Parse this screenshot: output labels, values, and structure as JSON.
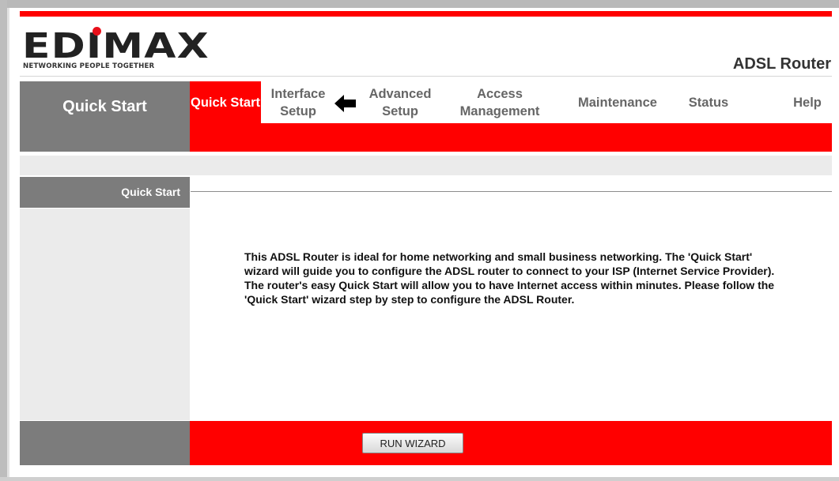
{
  "brand": {
    "logo_text": "EDIMAX",
    "tagline": "NETWORKING PEOPLE TOGETHER",
    "product": "ADSL Router",
    "accent_color": "#ff0000",
    "gray_color": "#7c7c7c"
  },
  "nav": {
    "section_title": "Quick Start",
    "tabs": [
      {
        "label": "Quick Start",
        "active": true
      },
      {
        "label": "Interface Setup",
        "active": false
      },
      {
        "label": "Advanced Setup",
        "active": false
      },
      {
        "label": "Access Management",
        "active": false
      },
      {
        "label": "Maintenance",
        "active": false
      },
      {
        "label": "Status",
        "active": false
      },
      {
        "label": "Help",
        "active": false
      }
    ],
    "pointer_icon": "left-arrow-icon"
  },
  "section": {
    "title": "Quick Start",
    "description": "This ADSL Router is ideal for home networking and small business networking. The 'Quick Start' wizard will guide you to configure the ADSL router to connect to your ISP (Internet Service Provider). The router's easy Quick Start will allow you to have Internet access within minutes. Please follow the 'Quick Start' wizard step by step to configure the ADSL Router."
  },
  "actions": {
    "run_wizard": "RUN WIZARD"
  }
}
